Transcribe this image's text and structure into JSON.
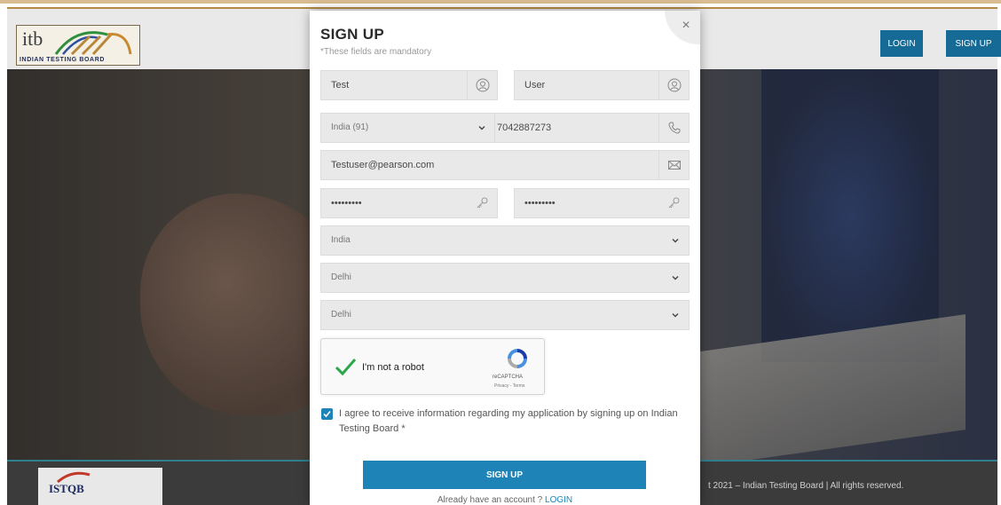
{
  "header": {
    "logo_text": "itb",
    "logo_subtitle": "INDIAN TESTING BOARD",
    "login_label": "LOGIN",
    "signup_label": "SIGN UP"
  },
  "footer": {
    "partner_logo_text": "ISTQB",
    "copyright": "t 2021 – Indian Testing Board | All rights reserved."
  },
  "modal": {
    "close_label": "×",
    "title": "SIGN UP",
    "subtitle": "*These fields are mandatory",
    "first_name": "Test",
    "last_name": "User",
    "country_code": "India (91)",
    "phone": "7042887273",
    "email": "Testuser@pearson.com",
    "password": "•••••••••",
    "confirm_password": "•••••••••",
    "country": "India",
    "state": "Delhi",
    "city": "Delhi",
    "captcha": {
      "label": "I'm not a robot",
      "brand": "reCAPTCHA",
      "links": "Privacy - Terms"
    },
    "agree_text": "I agree to receive information regarding my application by signing up on Indian Testing Board *",
    "submit_label": "SIGN UP",
    "already_text": "Already have an account ?",
    "login_link": "LOGIN"
  },
  "colors": {
    "primary": "#1e84b8",
    "header_button": "#156b95",
    "accent_line": "#b48a45"
  },
  "icons": [
    "user-icon",
    "phone-icon",
    "mail-icon",
    "key-icon",
    "chevron-down-icon",
    "checkmark-icon",
    "recaptcha-icon",
    "close-icon"
  ]
}
